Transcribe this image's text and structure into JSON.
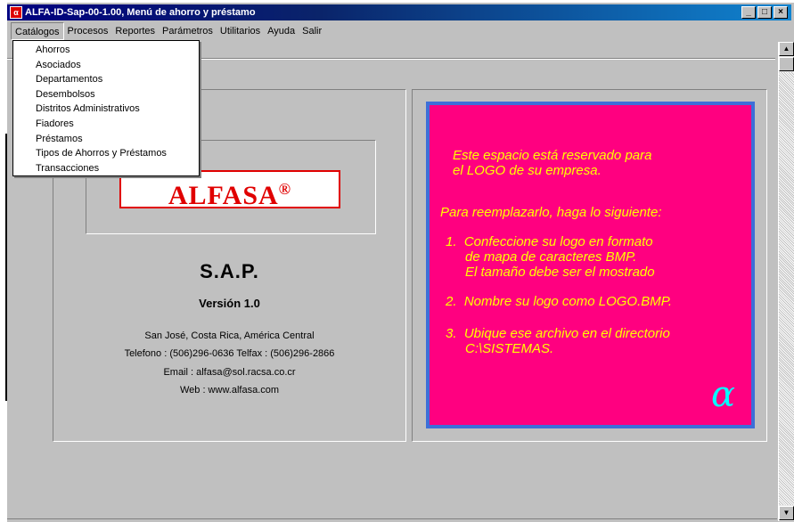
{
  "window": {
    "title": "ALFA-ID-Sap-00-1.00, Menú de ahorro y préstamo",
    "icon": "alfa-app-icon",
    "controls": [
      "minimize",
      "maximize",
      "close"
    ]
  },
  "menubar": {
    "items": [
      "Catálogos",
      "Procesos",
      "Reportes",
      "Parámetros",
      "Utilitarios",
      "Ayuda",
      "Salir"
    ],
    "active": "Catálogos"
  },
  "dropdown": {
    "items": [
      "Ahorros",
      "Asociados",
      "Departamentos",
      "Desembolsos",
      "Distritos Administrativos",
      "Fiadores",
      "Préstamos",
      "Tipos de Ahorros y Préstamos",
      "Transacciones"
    ]
  },
  "about": {
    "logo_text": "ALFASA",
    "logo_mark": "®",
    "product": "S.A.P.",
    "version": "Versión 1.0",
    "address": "San José, Costa Rica, América Central",
    "phone": "Telefono : (506)296-0636  Telfax : (506)296-2866",
    "email": "Email : alfasa@sol.racsa.co.cr",
    "web": "Web : www.alfasa.com"
  },
  "placeholder": {
    "line1": "Este espacio está reservado para",
    "line2": "el LOGO de su empresa.",
    "line3": "Para reemplazarlo, haga lo siguiente:",
    "step1a": "1.  Confeccione su logo en formato",
    "step1b": "de mapa de caracteres BMP.",
    "step1c": "El tamaño debe ser el mostrado",
    "step2": "2.  Nombre su logo como LOGO.BMP.",
    "step3a": "3.  Ubique ese archivo en el directorio",
    "step3b": "C:\\SISTEMAS.",
    "alpha": "α"
  },
  "colors": {
    "placeholder_bg": "#ff0080",
    "placeholder_text": "#ffff00",
    "placeholder_border": "#3d6fd8",
    "logo_red": "#e00000",
    "title_bar": "#000080"
  }
}
